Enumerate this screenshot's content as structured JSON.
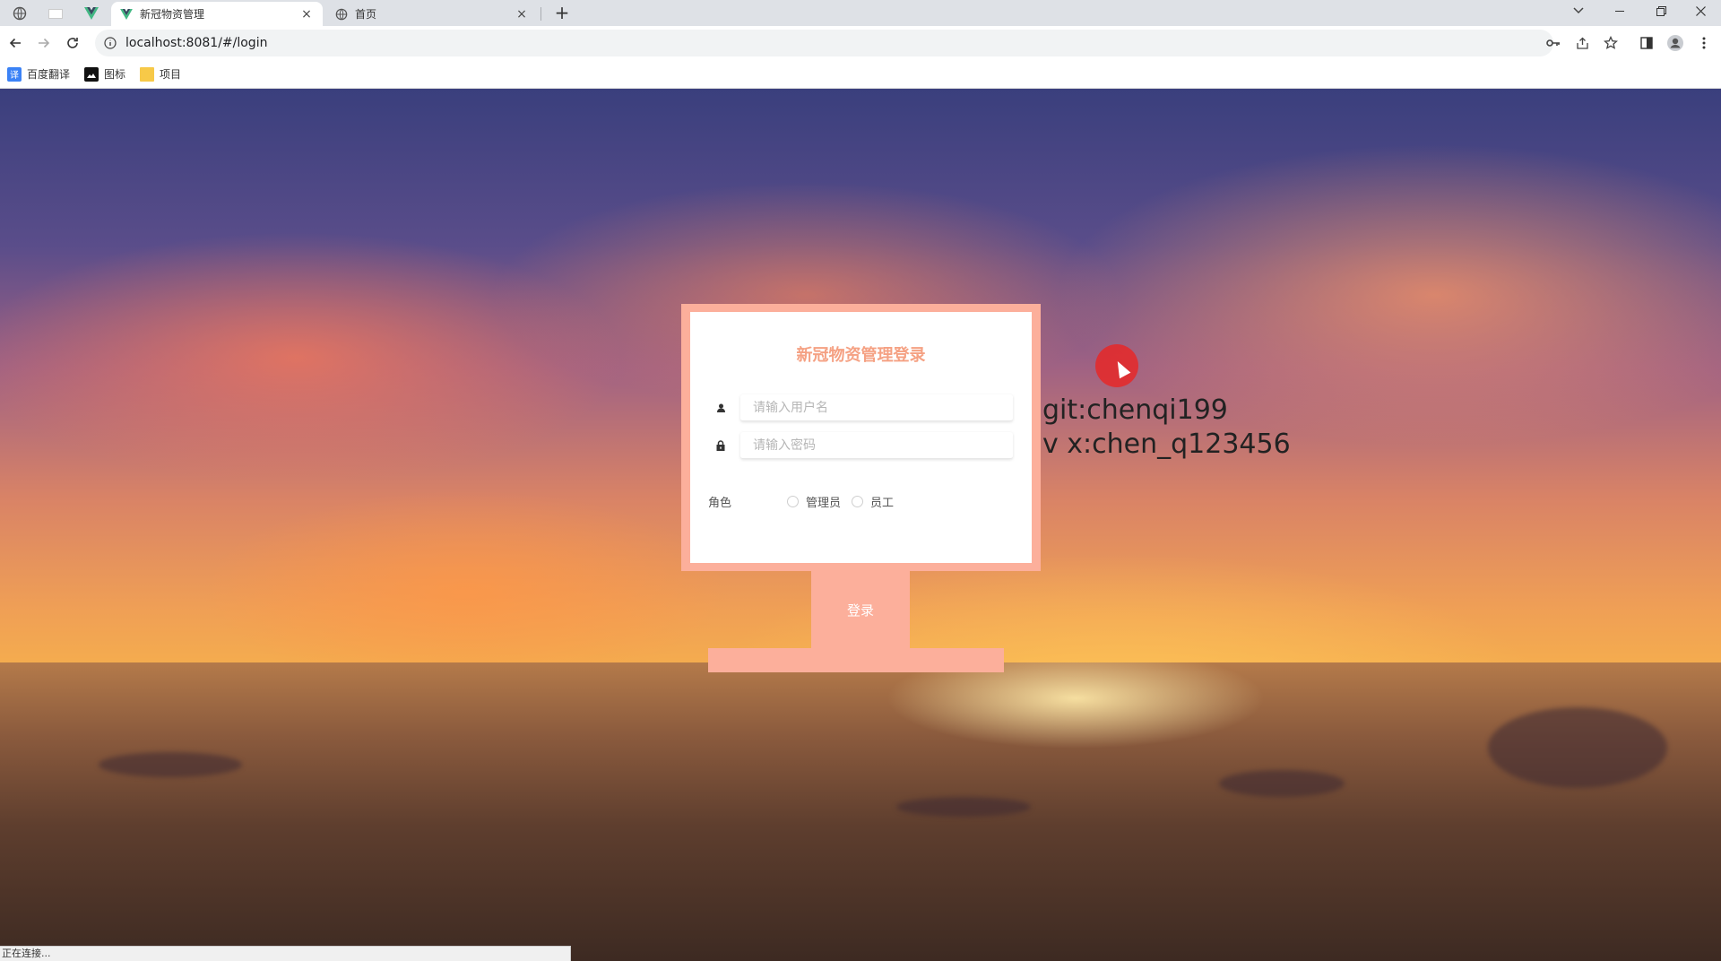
{
  "browser": {
    "tabs": [
      {
        "title": "新冠物资管理",
        "close": "×",
        "active": true
      },
      {
        "title": "首页",
        "close": "×",
        "active": false
      }
    ],
    "new_tab": "+",
    "url": "localhost:8081/#/login",
    "bookmarks": [
      {
        "label": "百度翻译",
        "icon": "translate-icon",
        "color": "#3b82f6"
      },
      {
        "label": "图标",
        "icon": "image-icon",
        "color": "#111111"
      },
      {
        "label": "项目",
        "icon": "folder-icon",
        "color": "#f7c948"
      }
    ],
    "status_text": "正在连接..."
  },
  "login": {
    "title": "新冠物资管理登录",
    "username_placeholder": "请输入用户名",
    "password_placeholder": "请输入密码",
    "role_label": "角色",
    "roles": [
      "管理员",
      "员工"
    ],
    "submit_label": "登录"
  },
  "watermark": {
    "line1": "git:chenqi199",
    "line2": "v x:chen_q123456"
  },
  "colors": {
    "accent": "#fcaf9b",
    "title": "#f5a183"
  }
}
